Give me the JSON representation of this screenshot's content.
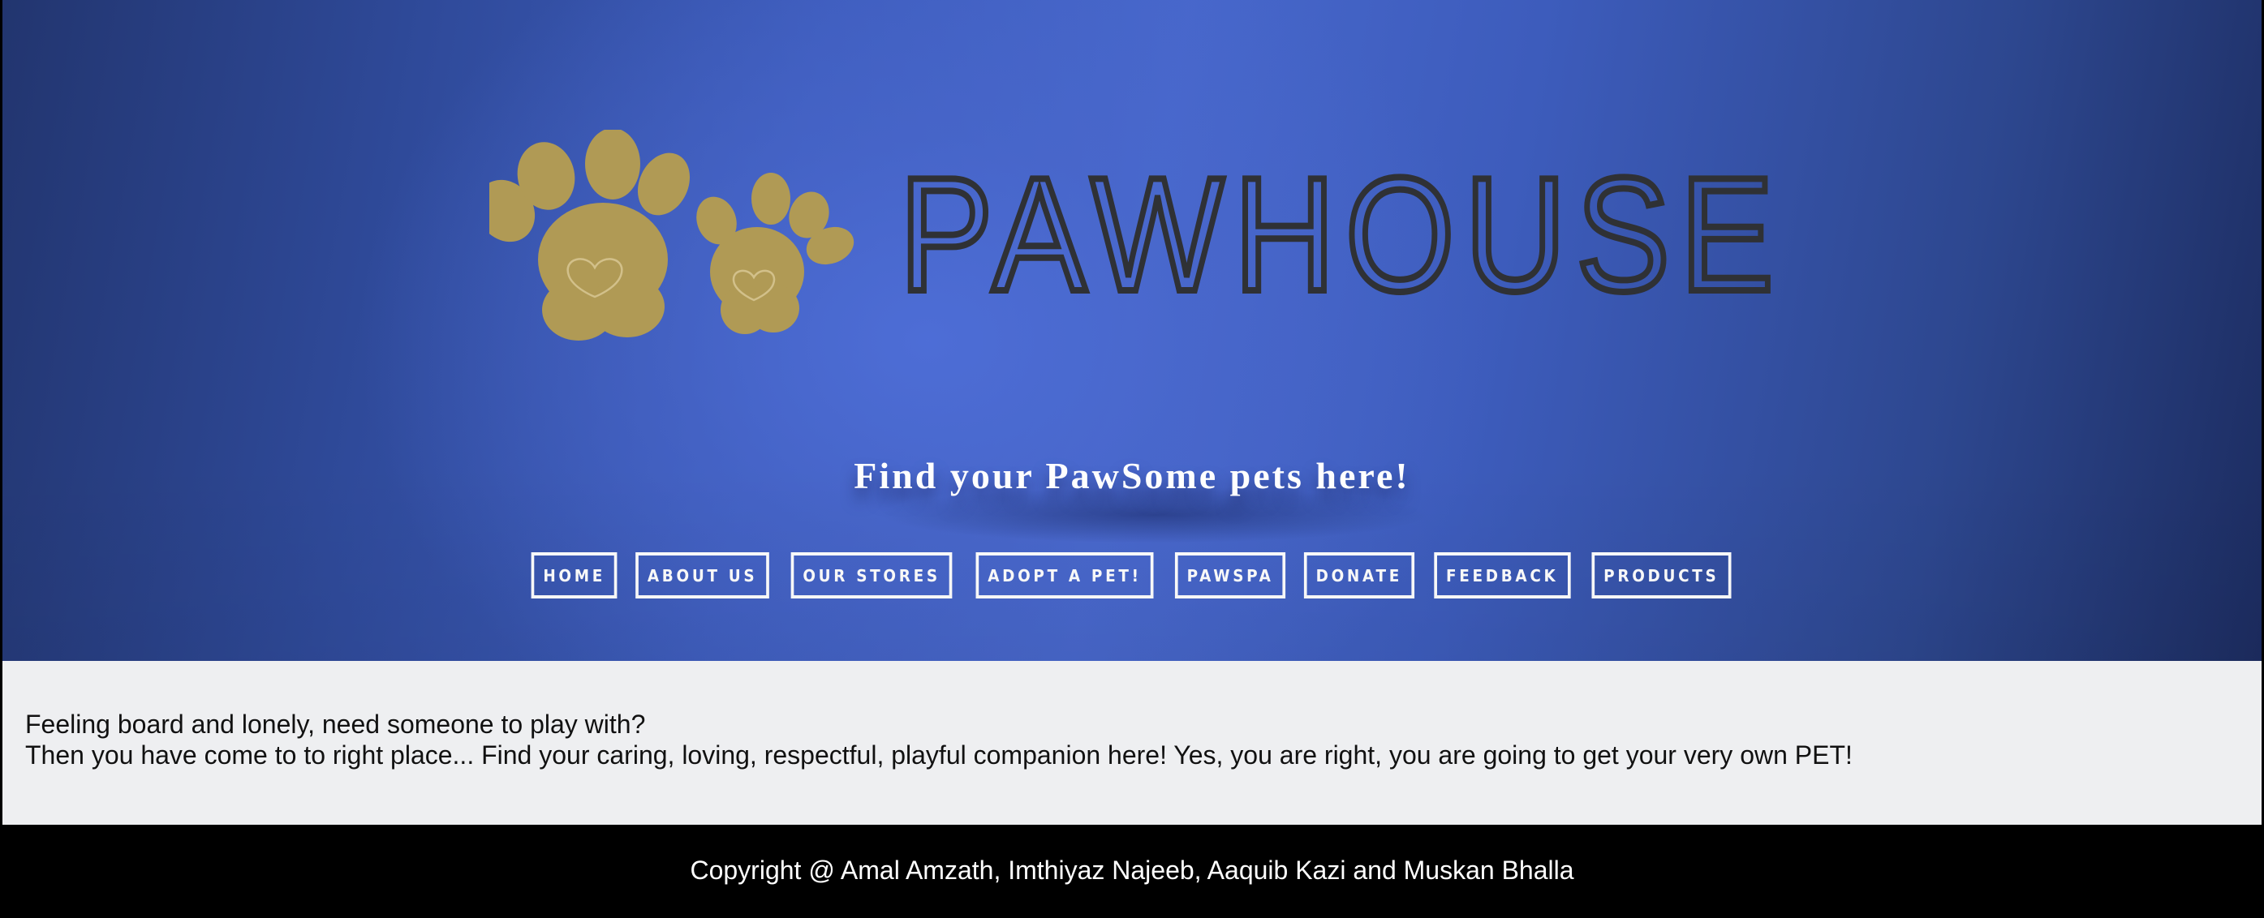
{
  "hero": {
    "logo_text": "PAWHOUSE",
    "logo_icon": "paw-prints-icon",
    "tagline": "Find your PawSome pets here!"
  },
  "nav": {
    "items": [
      {
        "label": "HOME"
      },
      {
        "label": "ABOUT US"
      },
      {
        "label": "OUR STORES"
      },
      {
        "label": "ADOPT A PET!"
      },
      {
        "label": "PAWSPA"
      },
      {
        "label": "DONATE"
      },
      {
        "label": "FEEDBACK"
      },
      {
        "label": "PRODUCTS"
      }
    ]
  },
  "content": {
    "line1": "Feeling board and lonely, need someone to play with?",
    "line2": "Then you have come to to right place... Find your caring, loving, respectful, playful companion here! Yes, you are right, you are going to get your very own PET!"
  },
  "footer": {
    "copyright": "Copyright @ Amal Amzath, Imthiyaz Najeeb, Aaquib Kazi and Muskan Bhalla"
  },
  "colors": {
    "paw": "#b09a55",
    "logo_text": "#2f3135",
    "hero_blue": "#4767cb",
    "content_bg": "#eeeff1"
  }
}
